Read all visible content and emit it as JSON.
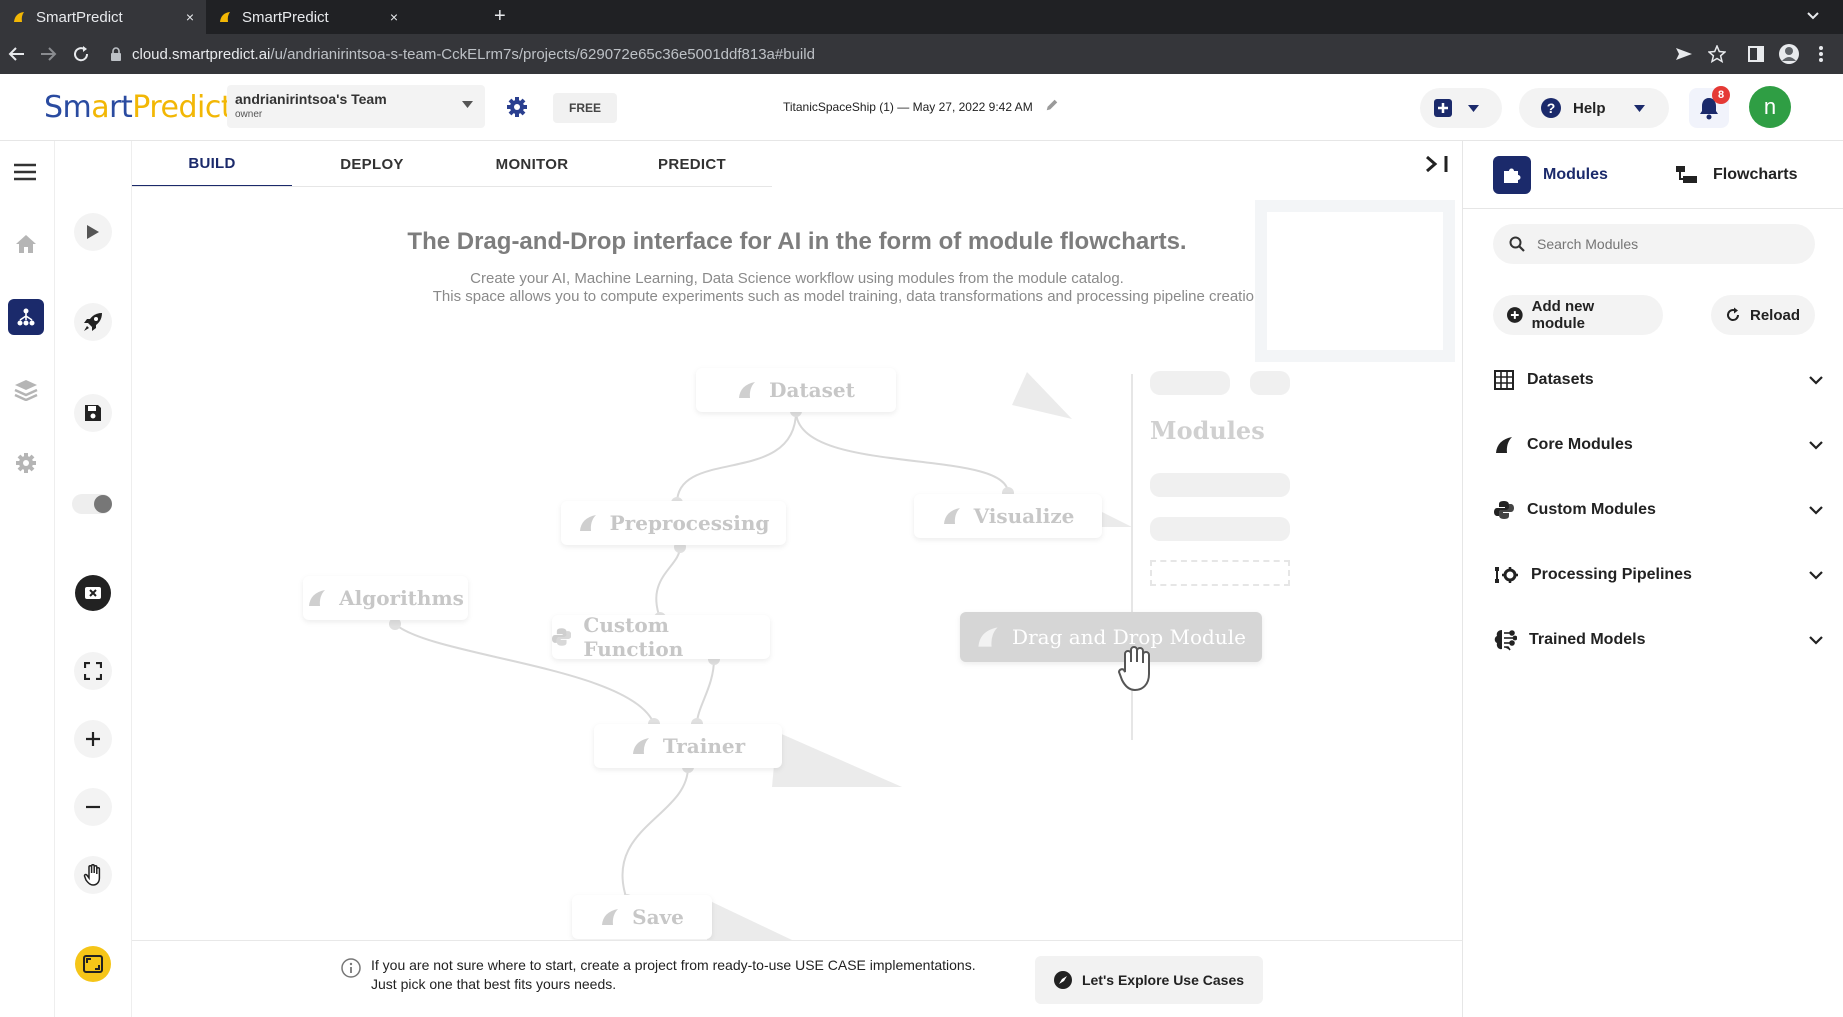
{
  "browser": {
    "tabs": [
      {
        "title": "SmartPredict",
        "close": "×"
      },
      {
        "title": "SmartPredict",
        "close": "×"
      }
    ],
    "new_tab": "+",
    "url_host": "cloud.smartpredict.ai",
    "url_path": "/u/andrianirintsoa-s-team-CckELrm7s/projects/629072e65c36e5001ddf813a#build"
  },
  "header": {
    "logo": {
      "part1": "Sm",
      "part2": "rt",
      "part3": "Predict"
    },
    "team_name": "andrianirintsoa's Team",
    "team_role": "owner",
    "plan": "FREE",
    "project_name": "TitanicSpaceShip (1)",
    "project_sep": "—",
    "project_date": "May 27, 2022 9:42 AM",
    "help_label": "Help",
    "notification_count": "8",
    "avatar_letter": "n"
  },
  "tabs": [
    {
      "label": "BUILD"
    },
    {
      "label": "DEPLOY"
    },
    {
      "label": "MONITOR"
    },
    {
      "label": "PREDICT"
    }
  ],
  "hero": {
    "title": "The Drag-and-Drop interface for AI in the form of module flowcharts.",
    "line1": "Create your AI, Machine Learning, Data Science workflow using modules from the module catalog.",
    "line2": "This space allows you to compute experiments such as model training, data transformations and processing pipeline creatio"
  },
  "illustration": {
    "nodes": {
      "dataset": "Dataset",
      "preprocessing": "Preprocessing",
      "visualize": "Visualize",
      "algorithms": "Algorithms",
      "custom_function": "Custom Function",
      "trainer": "Trainer",
      "save": "Save",
      "drag_drop": "Drag and Drop Module"
    },
    "panel_title": "Modules"
  },
  "bottom": {
    "tip_line1": "If you are not sure where to start, create a project from ready-to-use USE CASE implementations.",
    "tip_line2": "Just pick one that best fits yours needs.",
    "explore_label": "Let's Explore Use Cases"
  },
  "right_panel": {
    "tab_modules": "Modules",
    "tab_flowcharts": "Flowcharts",
    "search_placeholder": "Search Modules",
    "add_module": "Add new module",
    "reload": "Reload",
    "categories": [
      {
        "label": "Datasets",
        "icon": "grid-icon"
      },
      {
        "label": "Core Modules",
        "icon": "leaf-icon"
      },
      {
        "label": "Custom Modules",
        "icon": "python-icon"
      },
      {
        "label": "Processing Pipelines",
        "icon": "pipeline-icon"
      },
      {
        "label": "Trained Models",
        "icon": "brain-icon"
      }
    ]
  },
  "colors": {
    "accent": "#1b2a6b",
    "logo_yellow": "#f2b705",
    "logo_blue": "#2a4ba0",
    "avatar_green": "#2f9e44",
    "notif_red": "#e53935",
    "fit_yellow": "#f5c518"
  }
}
